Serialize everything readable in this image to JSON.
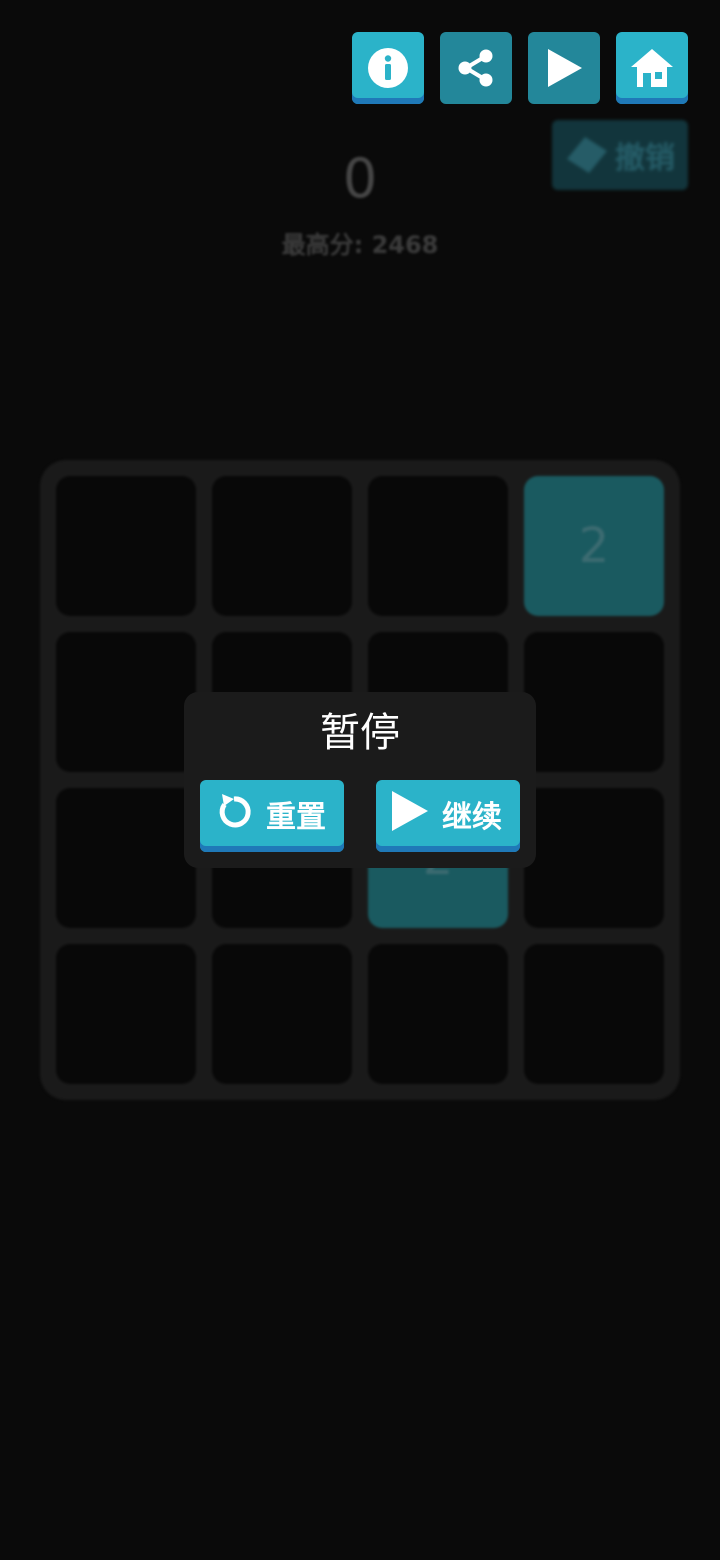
{
  "toolbar": {
    "buttons": [
      {
        "id": "info",
        "icon": "info-icon"
      },
      {
        "id": "share",
        "icon": "share-icon"
      },
      {
        "id": "play",
        "icon": "play-icon"
      },
      {
        "id": "home",
        "icon": "home-icon"
      }
    ],
    "undo_label": "撤销"
  },
  "score": {
    "current": "0",
    "best_label": "最高分: 2468"
  },
  "board": {
    "rows": [
      [
        "",
        "",
        "",
        "2"
      ],
      [
        "",
        "",
        "",
        ""
      ],
      [
        "",
        "",
        "2",
        ""
      ],
      [
        "",
        "",
        "",
        ""
      ]
    ]
  },
  "pause_dialog": {
    "title": "暂停",
    "reset_label": "重置",
    "resume_label": "继续"
  },
  "colors": {
    "accent": "#2bb3c9",
    "accent_shadow": "#1f79b8",
    "background": "#0a0a0a",
    "tile": "#1a5a60"
  }
}
